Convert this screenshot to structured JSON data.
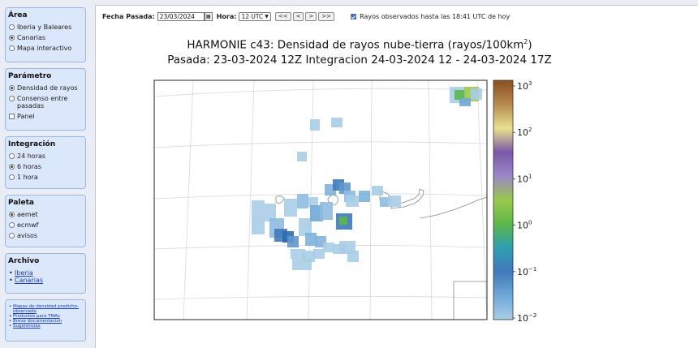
{
  "sidebar": {
    "area": {
      "title": "Área",
      "options": [
        "Iberia y Baleares",
        "Canarias",
        "Mapa interactivo"
      ],
      "selected": 1
    },
    "parametro": {
      "title": "Parámetro",
      "options": [
        "Densidad de rayos",
        "Consenso entre pasadas"
      ],
      "selected": 0,
      "panel_label": "Panel"
    },
    "integracion": {
      "title": "Integración",
      "options": [
        "24 horas",
        "6 horas",
        "1 hora"
      ],
      "selected": 1
    },
    "paleta": {
      "title": "Paleta",
      "options": [
        "aemet",
        "ecmwf",
        "avisos"
      ],
      "selected": 0
    },
    "archivo": {
      "title": "Archivo",
      "links": [
        "Iberia",
        "Canarias"
      ]
    },
    "links": [
      "Mapas de densidad predicho-observado",
      "Productos para TMAs",
      "Breve documentacion",
      "Sugerencias"
    ]
  },
  "toolbar": {
    "fecha_label": "Fecha Pasada:",
    "fecha_value": "23/03/2024",
    "hora_label": "Hora:",
    "hora_value": "12 UTC",
    "nav_buttons": [
      "<<",
      "<",
      ">",
      ">>"
    ],
    "rayos_label": "Rayos observados hasta las 18:41 UTC de hoy",
    "rayos_checked": true
  },
  "chart": {
    "title_line1_prefix": "HARMONIE c43: Densidad de rayos nube-tierra (rayos/100km",
    "title_line1_sup": "2",
    "title_line1_suffix": ")",
    "title_line2": "Pasada: 23-03-2024 12Z Integracion 24-03-2024 12 - 24-03-2024 17Z",
    "colorbar_ticks": [
      {
        "base": "10",
        "exp": "3",
        "value": 1000
      },
      {
        "base": "10",
        "exp": "2",
        "value": 100
      },
      {
        "base": "10",
        "exp": "1",
        "value": 10
      },
      {
        "base": "10",
        "exp": "0",
        "value": 1
      },
      {
        "base": "10",
        "exp": "−1",
        "value": 0.1
      },
      {
        "base": "10",
        "exp": "−2",
        "value": 0.01
      }
    ],
    "colorbar_colors": [
      "#a8cde6",
      "#6fa8d6",
      "#3f79bb",
      "#2f9fb0",
      "#5bb848",
      "#9ac94e",
      "#9b88c8",
      "#7a58a8",
      "#e8e28e",
      "#b48a4f",
      "#8a4f1e"
    ]
  },
  "chart_data": {
    "type": "heatmap",
    "title": "HARMONIE c43: Densidad de rayos nube-tierra (rayos/100km2)",
    "subtitle": "Pasada: 23-03-2024 12Z Integracion 24-03-2024 12 - 24-03-2024 17Z",
    "colorbar": {
      "scale": "log",
      "range": [
        0.01,
        1000
      ],
      "ticks": [
        1000,
        100,
        10,
        1,
        0.1,
        0.01
      ]
    }
  }
}
